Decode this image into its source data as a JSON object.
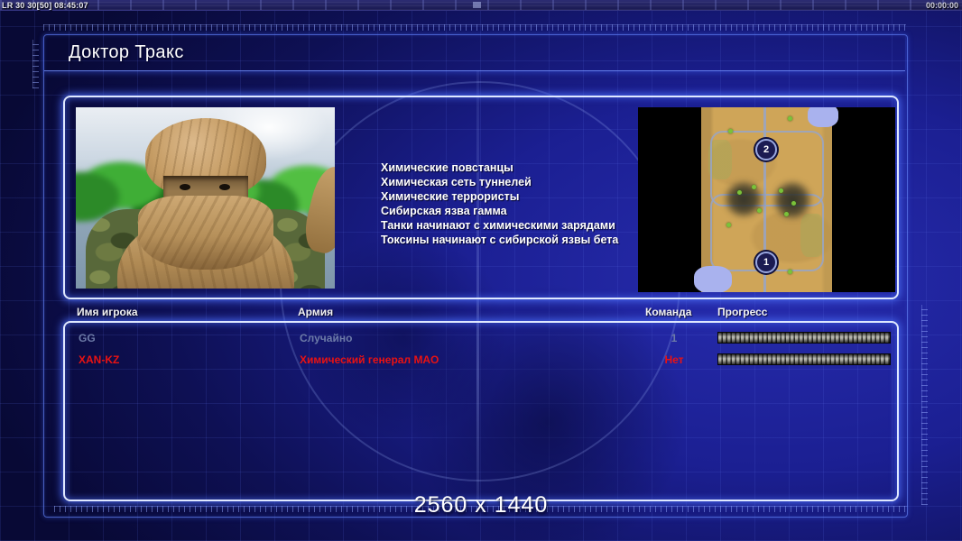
{
  "overlay": {
    "left_stats": "LR 30 30[50] 08:45:07",
    "right_timer": "00:00:00"
  },
  "title": "Доктор Тракс",
  "features": [
    "Химические повстанцы",
    "Химическая сеть туннелей",
    "Химические террористы",
    "Сибирская язва гамма",
    "Танки начинают с химическими зарядами",
    "Токсины начинают с сибирской язвы бета"
  ],
  "map": {
    "marker_top": "2",
    "marker_bottom": "1"
  },
  "table": {
    "headers": {
      "name": "Имя игрока",
      "army": "Армия",
      "team": "Команда",
      "progress": "Прогресс"
    },
    "rows": [
      {
        "name": "GG",
        "army": "Случайно",
        "team": "1",
        "progress_pct": 100,
        "color": "#6d7ba8"
      },
      {
        "name": "XAN-KZ",
        "army": "Химический генерал МАО",
        "team": "Нет",
        "progress_pct": 100,
        "color": "#ea1212"
      }
    ]
  },
  "resolution_label": "2560 x 1440",
  "colors": {
    "panel_glow": "#4664e6",
    "panel_border": "#dfe8ff",
    "background_deep": "#080935",
    "background_bright": "#272cae",
    "row_default_text": "#6d7ba8",
    "row_red_text": "#ea1212",
    "progress_segment": "#a9a99f"
  }
}
